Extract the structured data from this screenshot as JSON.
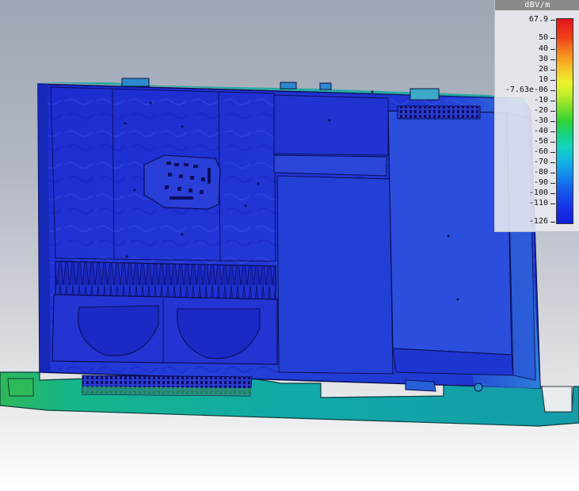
{
  "legend": {
    "unit": "dBV/m",
    "ticks": [
      "67.9",
      "50",
      "40",
      "30",
      "20",
      "10",
      "-7.63e-06",
      "-10",
      "-20",
      "-30",
      "-40",
      "-50",
      "-60",
      "-70",
      "-80",
      "-90",
      "-100",
      "-110",
      "-126"
    ]
  },
  "colors": {
    "field_low": "#1e2fd0",
    "field_mid": "#16a2a8",
    "field_high": "#6ad23a"
  }
}
